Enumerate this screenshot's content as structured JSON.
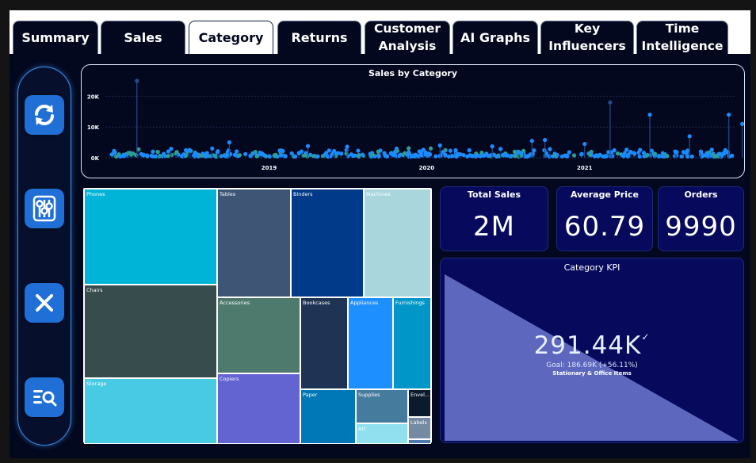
{
  "tabs": [
    {
      "id": "summary",
      "label": "Summary",
      "active": false
    },
    {
      "id": "sales",
      "label": "Sales",
      "active": false
    },
    {
      "id": "category",
      "label": "Category",
      "active": true
    },
    {
      "id": "returns",
      "label": "Returns",
      "active": false
    },
    {
      "id": "customer-analysis",
      "label": "Customer\nAnalysis",
      "active": false
    },
    {
      "id": "ai-graphs",
      "label": "AI Graphs",
      "active": false
    },
    {
      "id": "key-influencers",
      "label": "Key\nInfluencers",
      "active": false
    },
    {
      "id": "time-intelligence",
      "label": "Time\nIntelligence",
      "active": false
    }
  ],
  "sidebar": {
    "buttons": [
      {
        "id": "refresh",
        "icon": "refresh-icon"
      },
      {
        "id": "filters",
        "icon": "sliders-icon"
      },
      {
        "id": "clear",
        "icon": "close-icon"
      },
      {
        "id": "search-list",
        "icon": "list-search-icon"
      }
    ]
  },
  "colors": {
    "background": "#03081f",
    "accent": "#1f6fd6",
    "card": "#070a5c",
    "lollipop_main": "#1b8cff",
    "lollipop_alt": "#2e9e8f"
  },
  "chart_data": {
    "type": "scatter",
    "title": "Sales by Category",
    "xlabel": "",
    "ylabel": "",
    "x_ticks": [
      "2019",
      "2020",
      "2021"
    ],
    "y_ticks": [
      "0K",
      "10K",
      "20K"
    ],
    "ylim": [
      0,
      25000
    ],
    "grid": true,
    "style": "lollipop",
    "peaks": [
      {
        "x": "2018-03",
        "y": 25000
      },
      {
        "x": "2018-10",
        "y": 5000
      },
      {
        "x": "2019-04",
        "y": 3800
      },
      {
        "x": "2019-07",
        "y": 3600
      },
      {
        "x": "2020-02",
        "y": 4000
      },
      {
        "x": "2020-06",
        "y": 3700
      },
      {
        "x": "2020-09",
        "y": 5500
      },
      {
        "x": "2020-10",
        "y": 5800
      },
      {
        "x": "2021-01",
        "y": 4500
      },
      {
        "x": "2021-03",
        "y": 18000
      },
      {
        "x": "2021-06",
        "y": 14000
      },
      {
        "x": "2021-09",
        "y": 7000
      },
      {
        "x": "2021-12",
        "y": 14000
      },
      {
        "x": "2022-01",
        "y": 11000
      }
    ]
  },
  "treemap": {
    "tiles": [
      {
        "label": "Phones",
        "color": "#00b4d8"
      },
      {
        "label": "Chairs",
        "color": "#374c4d"
      },
      {
        "label": "Storage",
        "color": "#48cae4"
      },
      {
        "label": "Tables",
        "color": "#3e5575"
      },
      {
        "label": "Binders",
        "color": "#013a88"
      },
      {
        "label": "Machines",
        "color": "#a9d6dd"
      },
      {
        "label": "Accessories",
        "color": "#4e7a6d"
      },
      {
        "label": "Bookcases",
        "color": "#1f3455"
      },
      {
        "label": "Appliances",
        "color": "#1e8fff"
      },
      {
        "label": "Furnishings",
        "color": "#0096c7"
      },
      {
        "label": "Copiers",
        "color": "#6363d1"
      },
      {
        "label": "Paper",
        "color": "#0077b6"
      },
      {
        "label": "Supplies",
        "color": "#457b9d"
      },
      {
        "label": "Envel...",
        "color": "#0c1a2e"
      },
      {
        "label": "Labels",
        "color": "#758aa3"
      },
      {
        "label": "Art",
        "color": "#90e0ef"
      },
      {
        "label": "",
        "color": "#4c7ab1"
      }
    ]
  },
  "cards": {
    "total_sales": {
      "title": "Total Sales",
      "value": "2M"
    },
    "average_price": {
      "title": "Average Price",
      "value": "60.79"
    },
    "orders": {
      "title": "Orders",
      "value": "9990"
    }
  },
  "kpi": {
    "title": "Category KPI",
    "value": "291.44K",
    "goal": "Goal: 186.69K (+56.11%)",
    "category": "Stationary & Office Items",
    "check": "✓"
  }
}
